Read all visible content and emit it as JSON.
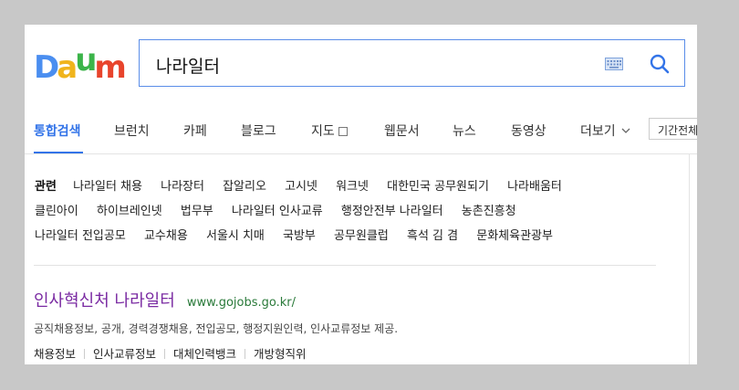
{
  "logo": {
    "text": "Daum",
    "letters": [
      "D",
      "a",
      "u",
      "m"
    ],
    "colors": [
      "#4a8ef0",
      "#f0b41c",
      "#3cb44a",
      "#e8442c"
    ]
  },
  "search": {
    "value": "나라일터"
  },
  "icons": {
    "keyboard": "keyboard-icon",
    "search": "search-icon",
    "map": "map-icon",
    "chevron": "chevron-down-icon"
  },
  "tabs": [
    {
      "label": "통합검색",
      "active": true
    },
    {
      "label": "브런치"
    },
    {
      "label": "카페"
    },
    {
      "label": "블로그"
    },
    {
      "label": "지도"
    },
    {
      "label": "웹문서"
    },
    {
      "label": "뉴스"
    },
    {
      "label": "동영상"
    },
    {
      "label": "더보기"
    }
  ],
  "period_select": "기간전체",
  "related": {
    "title": "관련",
    "rows": [
      [
        "나라일터 채용",
        "나라장터",
        "잡알리오",
        "고시넷",
        "워크넷",
        "대한민국 공무원되기",
        "나라배움터"
      ],
      [
        "클린아이",
        "하이브레인넷",
        "법무부",
        "나라일터 인사교류",
        "행정안전부 나라일터",
        "농촌진흥청"
      ],
      [
        "나라일터 전입공모",
        "교수채용",
        "서울시 치매",
        "국방부",
        "공무원클럽",
        "흑석 김 겸",
        "문화체육관광부"
      ]
    ]
  },
  "result": {
    "title": "인사혁신처 나라일터",
    "url": "www.gojobs.go.kr/",
    "description": "공직채용정보, 공개, 경력경쟁채용, 전입공모, 행정지원인력, 인사교류정보 제공.",
    "sitelinks": [
      "채용정보",
      "인사교류정보",
      "대체인력뱅크",
      "개방형직위"
    ]
  },
  "colors": {
    "accent": "#3374e8",
    "result_title": "#7a2aa2",
    "url": "#2a7a3a",
    "search_border": "#5a8de8"
  }
}
